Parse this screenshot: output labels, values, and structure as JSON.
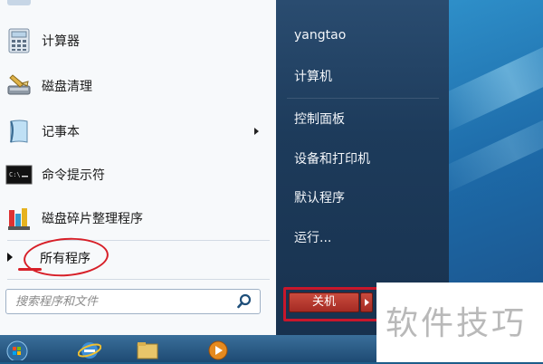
{
  "start_menu": {
    "programs": [
      {
        "label": "计算器",
        "icon": "calculator-icon"
      },
      {
        "label": "磁盘清理",
        "icon": "disk-cleanup-icon"
      },
      {
        "label": "记事本",
        "icon": "notepad-icon",
        "has_submenu": true
      },
      {
        "label": "命令提示符",
        "icon": "command-prompt-icon"
      },
      {
        "label": "磁盘碎片整理程序",
        "icon": "defrag-icon"
      }
    ],
    "all_programs_label": "所有程序",
    "search_placeholder": "搜索程序和文件",
    "right_items": [
      "yangtao",
      "计算机",
      "控制面板",
      "设备和打印机",
      "默认程序",
      "运行..."
    ],
    "shutdown_label": "关机"
  },
  "watermark": "软件技巧",
  "colors": {
    "highlight_red": "#d71f28",
    "right_pane": "#1d3b5b",
    "left_pane": "#f7f9fb"
  }
}
